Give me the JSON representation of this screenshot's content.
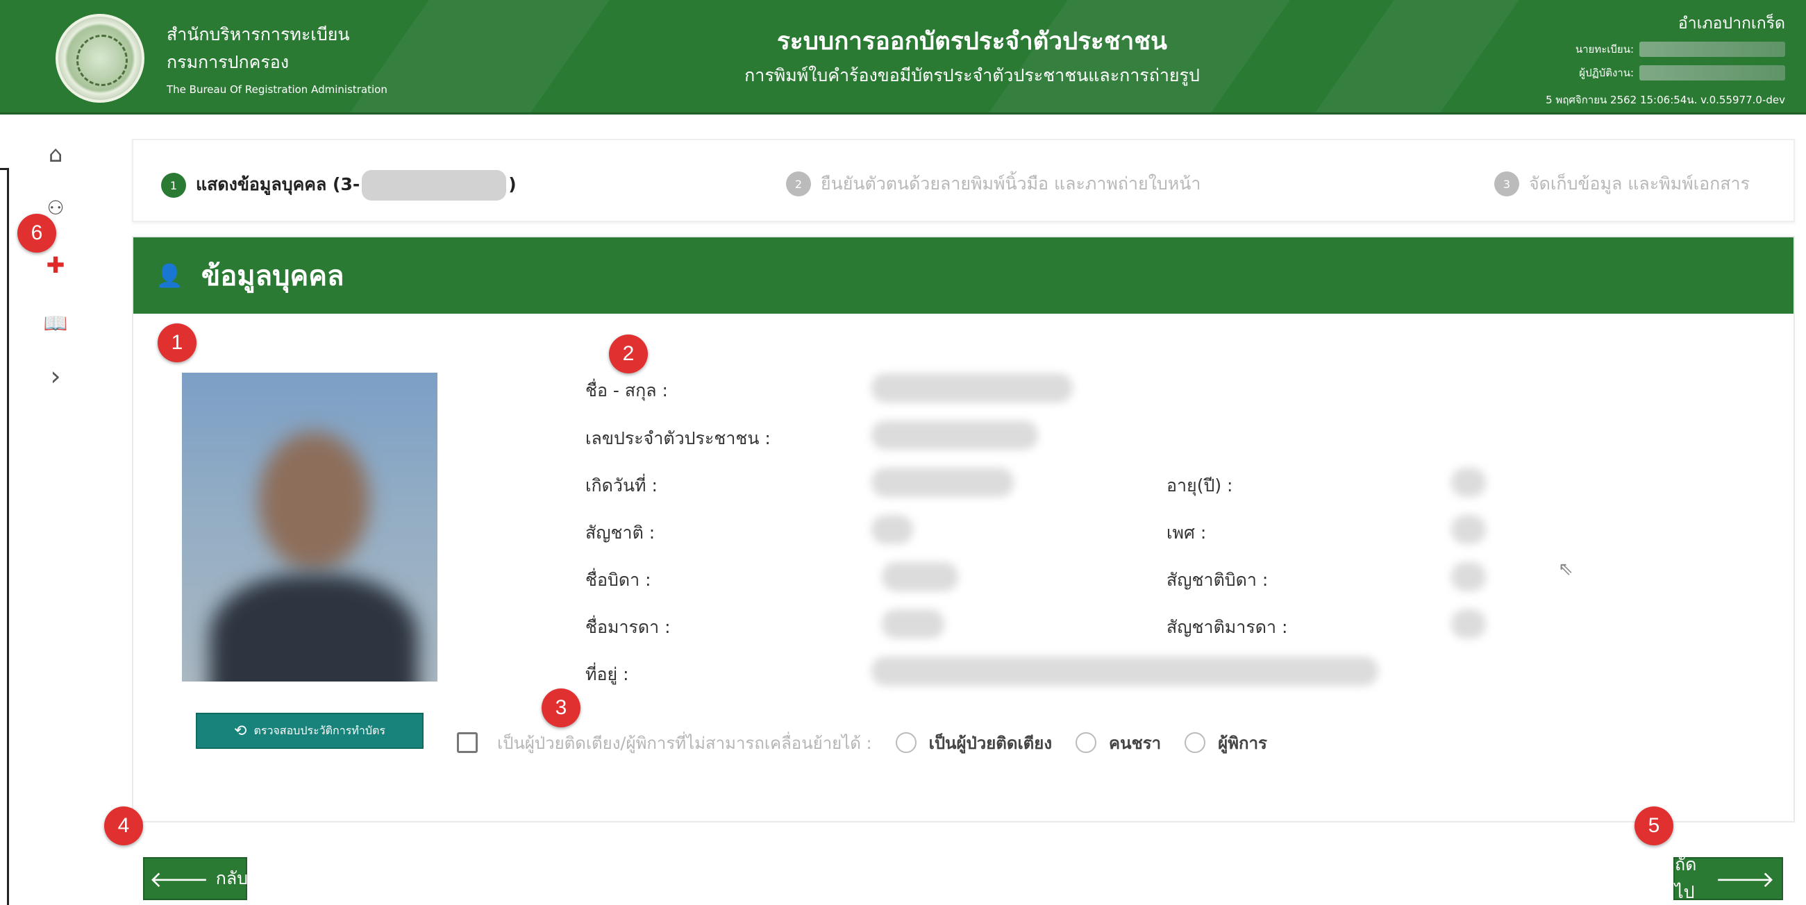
{
  "header": {
    "org_line1": "สำนักบริหารการทะเบียน",
    "org_line2": "กรมการปกครอง",
    "org_line3": "The Bureau Of Registration Administration",
    "system_title": "ระบบการออกบัตรประจำตัวประชาชน",
    "system_subtitle": "การพิมพ์ใบคำร้องขอมีบัตรประจำตัวประชาชนและการถ่ายรูป",
    "district": "อำเภอปากเกร็ด",
    "registrar_label": "นายทะเบียน:",
    "operator_label": "ผู้ปฏิบัติงาน:",
    "timestamp": "5 พฤศจิกายน 2562 15:06:54น.  v.0.55977.0-dev"
  },
  "sidebar": {
    "icons": [
      "home-icon",
      "person-icon",
      "add-icon",
      "book-icon",
      "chevron-right-icon"
    ],
    "home": "⌂",
    "person": "⚇",
    "add": "✚",
    "book": "📖",
    "expand": "›"
  },
  "stepper": {
    "step1_num": "1",
    "step1_label_prefix": "แสดงข้อมูลบุคคล (3-",
    "step1_label_suffix": ")",
    "step2_num": "2",
    "step2_label": "ยืนยันตัวตนด้วยลายพิมพ์นิ้วมือ และภาพถ่ายใบหน้า",
    "step3_num": "3",
    "step3_label": "จัดเก็บข้อมูล และพิมพ์เอกสาร"
  },
  "panel": {
    "icon": "👤",
    "title": "ข้อมูลบุคคล",
    "history_icon": "⟲",
    "history_button": "ตรวจสอบประวัติการทำบัตร"
  },
  "fields": {
    "name": "ชื่อ - สกุล :",
    "citizen_id": "เลขประจำตัวประชาชน :",
    "birth_date": "เกิดวันที่ :",
    "age": "อายุ(ปี) :",
    "nationality": "สัญชาติ :",
    "gender": "เพศ :",
    "father_name": "ชื่อบิดา :",
    "father_nationality": "สัญชาติบิดา :",
    "mother_name": "ชื่อมารดา :",
    "mother_nationality": "สัญชาติมารดา :",
    "address": "ที่อยู่ :"
  },
  "options": {
    "bedridden_checkbox": "เป็นผู้ป่วยติดเตียง/ผู้พิการที่ไม่สามารถเคลื่อนย้ายได้ :",
    "radio1": "เป็นผู้ป่วยติดเตียง",
    "radio2": "คนชรา",
    "radio3": "ผู้พิการ"
  },
  "nav": {
    "back_arrow": "🡐",
    "back": "กลับ",
    "next": "ถัดไป",
    "next_arrow": "🡒"
  },
  "badges": [
    "1",
    "2",
    "3",
    "4",
    "5",
    "6"
  ],
  "cursor": "⇖",
  "colors": {
    "primary_green": "#2b7a34",
    "teal_button": "#17837a",
    "badge_red": "#e03030"
  }
}
